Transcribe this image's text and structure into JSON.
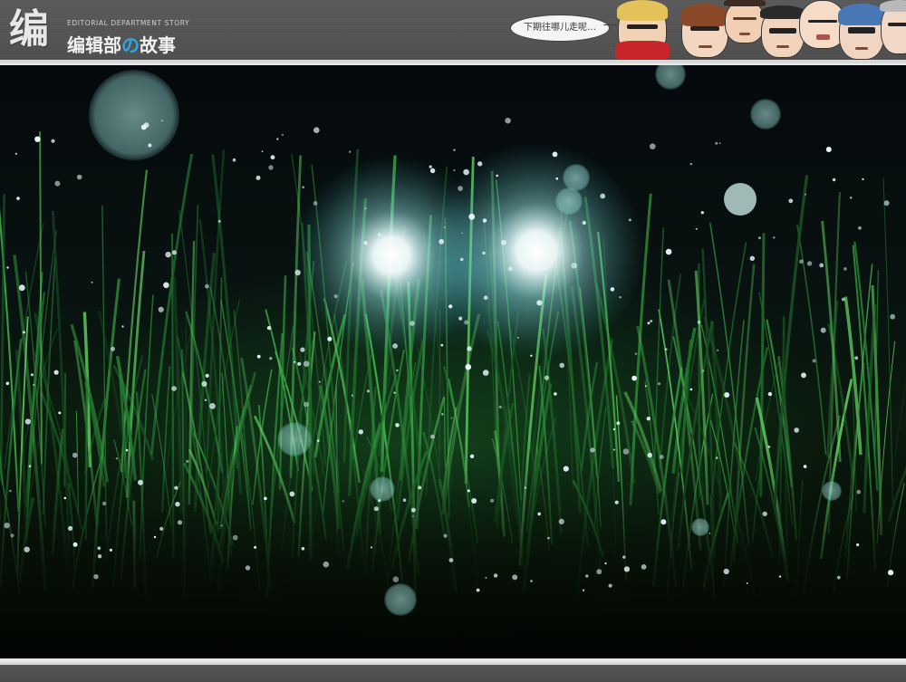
{
  "header": {
    "logo_glyph": "编",
    "logo_subtitle": "EDITORIAL DEPARTMENT STORY",
    "logo_title_part1": "编辑部",
    "logo_title_accent": "の",
    "logo_title_part2": "故事",
    "speech_bubble": "下期往哪儿走呢…",
    "characters": [
      {
        "icon": "character-sunglasses-red-scarf-icon"
      },
      {
        "icon": "character-brown-hair-woman-icon"
      },
      {
        "icon": "character-angry-man-icon"
      },
      {
        "icon": "character-sunglasses-man-icon"
      },
      {
        "icon": "character-bald-smiling-man-icon"
      },
      {
        "icon": "character-blue-hair-woman-icon"
      },
      {
        "icon": "character-partial-face-icon"
      }
    ]
  },
  "photo": {
    "subject": "night-grass-dewdrops-headlights-photo",
    "colors": {
      "grass": "#2f8f3a",
      "highlight": "#e9fbff",
      "bokeh": "#8fd4d0",
      "background": "#05090d"
    }
  },
  "colors": {
    "bar": "#525252",
    "accent": "#2ea6e6",
    "page_background": "#e9e9e9"
  }
}
